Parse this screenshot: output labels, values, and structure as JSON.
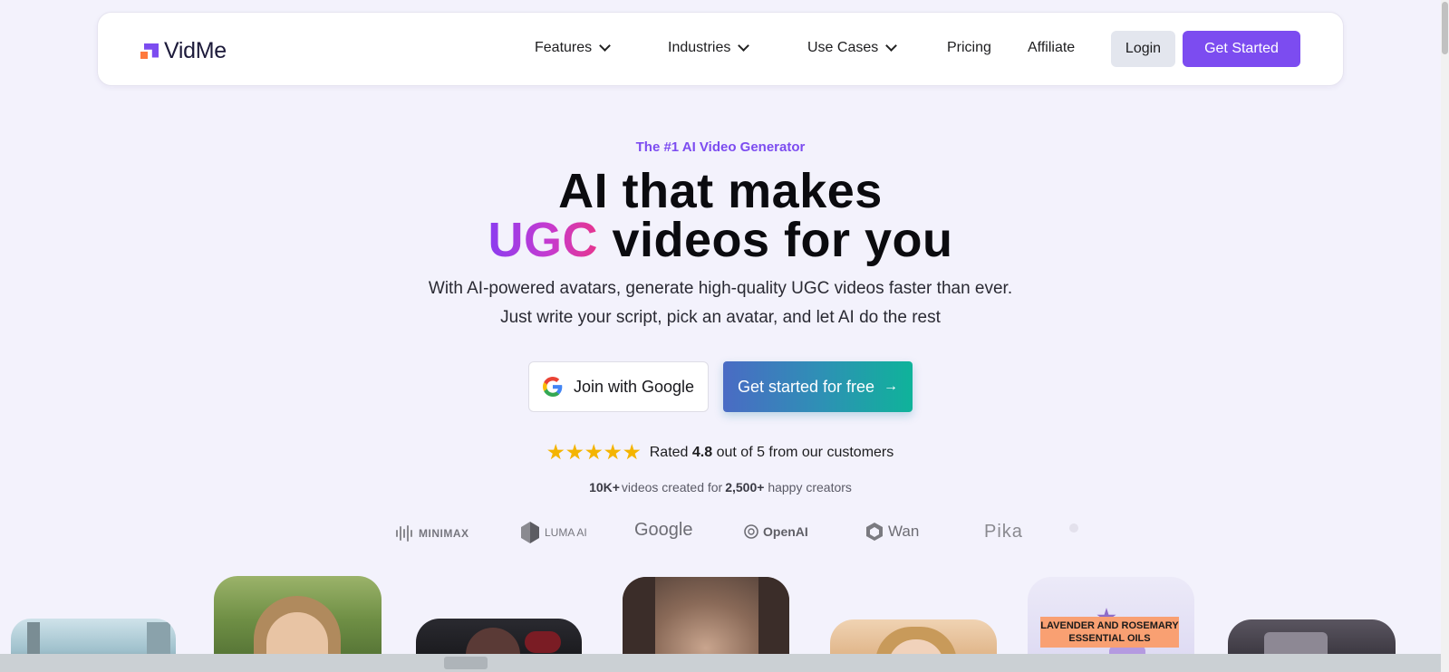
{
  "nav": {
    "logo_text": "VidMe",
    "items": [
      {
        "label": "Features"
      },
      {
        "label": "Industries"
      },
      {
        "label": "Use Cases"
      },
      {
        "label": "Pricing"
      },
      {
        "label": "Affiliate"
      }
    ],
    "login_label": "Login",
    "get_started_label": "Get Started"
  },
  "hero": {
    "eyebrow": "The #1 AI Video Generator",
    "title_line1": "AI that makes",
    "title_highlight": "UGC",
    "title_line2_rest": " videos for you",
    "subtitle_line1": "With AI-powered avatars, generate high-quality UGC videos faster than ever.",
    "subtitle_line2": "Just write your script, pick an avatar, and let AI do the rest",
    "google_button": "Join with Google",
    "free_button": "Get started for free",
    "free_button_arrow": "→"
  },
  "rating": {
    "prefix": "Rated",
    "value": "4.8",
    "suffix": "out of 5 from our customers",
    "stars": 5
  },
  "stats": {
    "videos": "10K+",
    "videos_text": "videos created for",
    "creators": "2,500+",
    "creators_text": "happy creators"
  },
  "partners": [
    {
      "name": "MINIMAX"
    },
    {
      "name": "LUMA AI"
    },
    {
      "name": "Google"
    },
    {
      "name": "OpenAI"
    },
    {
      "name": "Wan"
    },
    {
      "name": "Pika"
    }
  ],
  "cards": {
    "product_label": "LAVENDER AND ROSEMARY ESSENTIAL OILS"
  },
  "colors": {
    "brand": "#7c4cf0",
    "accent_orange": "#ff7a3d",
    "background": "#f3f2fc"
  }
}
